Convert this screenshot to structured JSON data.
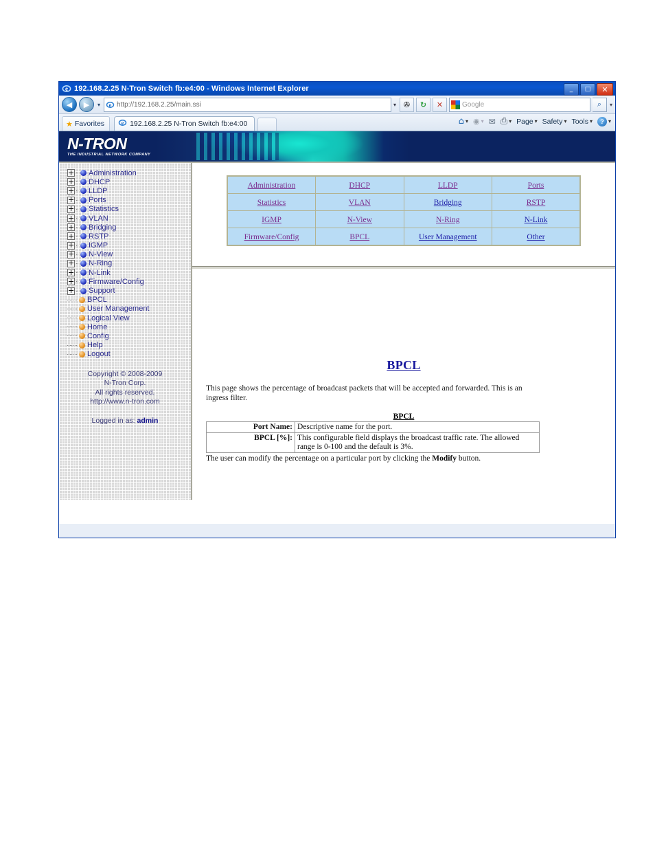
{
  "browser": {
    "title": "192.168.2.25 N-Tron Switch fb:e4:00 - Windows Internet Explorer",
    "minimize_label": "_",
    "maximize_label": "□",
    "close_label": "✕",
    "back_label": "◀",
    "forward_label": "▶",
    "history_caret": "▾",
    "url": "http://192.168.2.25/main.ssi",
    "url_caret": "▾",
    "compat_label": "✇",
    "refresh_label": "↻",
    "stop_label": "✕",
    "search_placeholder": "Google",
    "search_go_label": "⌕",
    "search_caret": "▾",
    "favorites_label": "Favorites",
    "tab_label": "192.168.2.25 N-Tron Switch fb:e4:00",
    "commandbar": {
      "home_label": "⌂",
      "feeds_label": "◉",
      "mail_label": "✉",
      "print_label": "⎙",
      "page_label": "Page",
      "safety_label": "Safety",
      "tools_label": "Tools",
      "help_label": "?",
      "caret": "▾"
    }
  },
  "banner": {
    "logo_text": "N-TRON",
    "tagline": "THE INDUSTRIAL NETWORK COMPANY"
  },
  "sidebar": {
    "tree": [
      {
        "label": "Administration",
        "type": "branch",
        "bullet": "blue"
      },
      {
        "label": "DHCP",
        "type": "branch",
        "bullet": "blue"
      },
      {
        "label": "LLDP",
        "type": "branch",
        "bullet": "blue"
      },
      {
        "label": "Ports",
        "type": "branch",
        "bullet": "blue"
      },
      {
        "label": "Statistics",
        "type": "branch",
        "bullet": "blue"
      },
      {
        "label": "VLAN",
        "type": "branch",
        "bullet": "blue"
      },
      {
        "label": "Bridging",
        "type": "branch",
        "bullet": "blue"
      },
      {
        "label": "RSTP",
        "type": "branch",
        "bullet": "blue"
      },
      {
        "label": "IGMP",
        "type": "branch",
        "bullet": "blue"
      },
      {
        "label": "N-View",
        "type": "branch",
        "bullet": "blue"
      },
      {
        "label": "N-Ring",
        "type": "branch",
        "bullet": "blue"
      },
      {
        "label": "N-Link",
        "type": "branch",
        "bullet": "blue"
      },
      {
        "label": "Firmware/Config",
        "type": "branch",
        "bullet": "blue"
      },
      {
        "label": "Support",
        "type": "branch",
        "bullet": "blue"
      },
      {
        "label": "BPCL",
        "type": "leaf",
        "bullet": "orange"
      },
      {
        "label": "User Management",
        "type": "leaf",
        "bullet": "orange"
      },
      {
        "label": "Logical View",
        "type": "leaf",
        "bullet": "orange"
      },
      {
        "label": "Home",
        "type": "leaf",
        "bullet": "orange"
      },
      {
        "label": "Config",
        "type": "leaf",
        "bullet": "orange"
      },
      {
        "label": "Help",
        "type": "leaf",
        "bullet": "orange"
      },
      {
        "label": "Logout",
        "type": "leaf",
        "bullet": "orange"
      }
    ],
    "footer": {
      "line1": "Copyright © 2008-2009",
      "line2": "N-Tron Corp.",
      "line3": "All rights reserved.",
      "line4": "http://www.n-tron.com",
      "logged_in_prefix": "Logged in as:",
      "logged_in_user": "admin"
    }
  },
  "content": {
    "link_table": {
      "rows": [
        [
          {
            "label": "Administration",
            "color": "purple"
          },
          {
            "label": "DHCP",
            "color": "purple"
          },
          {
            "label": "LLDP",
            "color": "purple"
          },
          {
            "label": "Ports",
            "color": "purple"
          }
        ],
        [
          {
            "label": "Statistics",
            "color": "purple"
          },
          {
            "label": "VLAN",
            "color": "purple"
          },
          {
            "label": "Bridging",
            "color": "blue"
          },
          {
            "label": "RSTP",
            "color": "purple"
          }
        ],
        [
          {
            "label": "IGMP",
            "color": "purple"
          },
          {
            "label": "N-View",
            "color": "purple"
          },
          {
            "label": "N-Ring",
            "color": "purple"
          },
          {
            "label": "N-Link",
            "color": "blue"
          }
        ],
        [
          {
            "label": "Firmware/Config",
            "color": "purple"
          },
          {
            "label": "BPCL",
            "color": "purple"
          },
          {
            "label": "User Management",
            "color": "blue"
          },
          {
            "label": "Other",
            "color": "blue"
          }
        ]
      ]
    },
    "heading": "BPCL",
    "description": "This page shows the percentage of broadcast packets that will be accepted and forwarded. This is an ingress filter.",
    "def_table": {
      "caption": "BPCL",
      "rows": [
        {
          "key": "Port Name:",
          "value": "Descriptive name for the port."
        },
        {
          "key": "BPCL [%]:",
          "value": "This configurable field displays the broadcast traffic rate. The allowed range is 0-100 and the default is 3%."
        }
      ]
    },
    "note_before": "The user can modify the percentage on a particular port by clicking the ",
    "note_bold": "Modify",
    "note_after": " button."
  },
  "colors": {
    "titlebar_blue": "#0a56d0",
    "banner_navy": "#0b2360",
    "banner_teal": "#19e6d2",
    "link_purple": "#7b2d8e",
    "link_blue": "#2222aa",
    "table_cell_bg": "#b9dcf5",
    "table_border": "#b3b392",
    "heading_blue": "#1a1a9e",
    "sidebar_bg": "#d9d9d9"
  }
}
